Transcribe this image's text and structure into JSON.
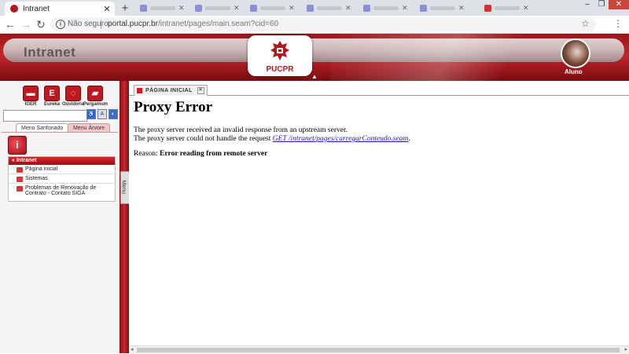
{
  "browser": {
    "tab_title": "Intranet",
    "new_tab": "+",
    "security_label": "Não seguro",
    "url_host": "portal.pucpr.br",
    "url_path": "/intranet/pages/main.seam?cid=60",
    "window_controls": [
      "–",
      "❐",
      "✕"
    ]
  },
  "header": {
    "site_title": "Intranet",
    "logo_text": "PUCPR",
    "user_label": "Aluno",
    "brand_color": "#b4161b"
  },
  "sidebar": {
    "shortcuts": [
      {
        "label": "IGER",
        "icon": "document-icon"
      },
      {
        "label": "Eureka",
        "icon": "e-icon"
      },
      {
        "label": "Ouvidoria",
        "icon": "speech-icon"
      },
      {
        "label": "Pergamum",
        "icon": "books-icon"
      }
    ],
    "accessibility_icons": [
      "wheelchair-icon",
      "font-icon",
      "ear-icon"
    ],
    "menu_tabs": [
      "Menu Sanfonado",
      "Menu Árvore"
    ],
    "accordion_title": "Intranet",
    "items": [
      "Página inicial",
      "Sistemas",
      "Problemas de Renovação de Contrato - Contato SIGA"
    ],
    "rail_label": "Menu"
  },
  "content": {
    "tab_label": "PÁGINA INICIAL",
    "error_title": "Proxy Error",
    "line1": "The proxy server received an invalid response from an upstream server.",
    "line2_prefix": "The proxy server could not handle the request ",
    "line2_link": "GET /intranet/pages/carregarConteudo.seam",
    "line2_suffix": ".",
    "reason_prefix": "Reason: ",
    "reason_text": "Error reading from remote server"
  }
}
